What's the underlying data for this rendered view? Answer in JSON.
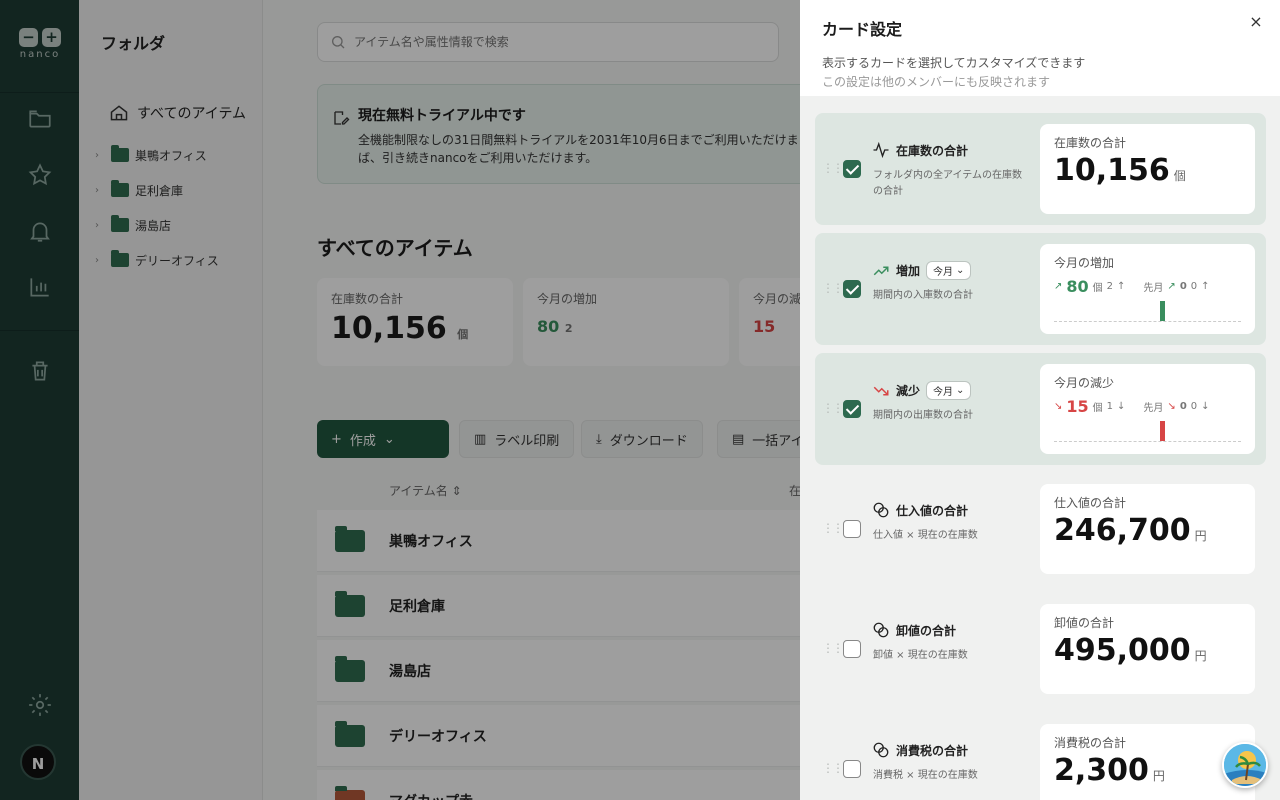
{
  "brand": {
    "logo_text": "nanco",
    "logo_mark_minus": "−",
    "logo_mark_plus": "+"
  },
  "user": {
    "avatar_initial": "N"
  },
  "folders": {
    "title": "フォルダ",
    "all_items": "すべてのアイテム",
    "items": [
      "巣鴨オフィス",
      "足利倉庫",
      "湯島店",
      "デリーオフィス"
    ]
  },
  "search": {
    "placeholder": "アイテム名や属性情報で検索"
  },
  "trial": {
    "title": "現在無料トライアル中です",
    "line1": "全機能制限なしの31日間無料トライアルを2031年10月6日までご利用いただけま",
    "line2": "ば、引き続きnancoをご利用いただけます。"
  },
  "main": {
    "heading": "すべてのアイテム",
    "cards": [
      {
        "title": "在庫数の合計",
        "value": "10,156",
        "unit": "個"
      },
      {
        "title": "今月の増加",
        "value": "80",
        "unit": "2"
      },
      {
        "title": "今月の減",
        "value": "15",
        "unit": ""
      }
    ],
    "toolbar": {
      "create": "作成",
      "label_print": "ラベル印刷",
      "download": "ダウンロード",
      "bulk": "一括アイ"
    },
    "column_header": "アイテム名",
    "column_header2": "在",
    "rows": [
      "巣鴨オフィス",
      "足利倉庫",
      "湯島店",
      "デリーオフィス",
      "マグカップ赤"
    ]
  },
  "panel": {
    "title": "カード設定",
    "subtitle1": "表示するカードを選択してカスタマイズできます",
    "subtitle2": "この設定は他のメンバーにも反映されます",
    "close_label": "×",
    "settings": [
      {
        "enabled": true,
        "icon": "activity-icon",
        "title": "在庫数の合計",
        "period": "",
        "desc": "フォルダ内の全アイテムの在庫数の合計",
        "preview": {
          "title": "在庫数の合計",
          "value": "10,156",
          "unit": "個"
        }
      },
      {
        "enabled": true,
        "icon": "trend-up-icon",
        "title": "増加",
        "period": "今月",
        "desc": "期間内の入庫数の合計",
        "preview": {
          "title": "今月の増加",
          "value": "80",
          "unit": "個",
          "count": "2",
          "prev_label": "先月",
          "prev_value": "0",
          "prev_count": "0",
          "bar_fraction": 1.0
        }
      },
      {
        "enabled": true,
        "icon": "trend-down-icon",
        "title": "減少",
        "period": "今月",
        "desc": "期間内の出庫数の合計",
        "preview": {
          "title": "今月の減少",
          "value": "15",
          "unit": "個",
          "count": "1",
          "prev_label": "先月",
          "prev_value": "0",
          "prev_count": "0",
          "bar_fraction": 1.0
        }
      },
      {
        "enabled": false,
        "icon": "coins-icon",
        "title": "仕入値の合計",
        "period": "",
        "desc": "仕入値 × 現在の在庫数",
        "preview": {
          "title": "仕入値の合計",
          "value": "246,700",
          "unit": "円"
        }
      },
      {
        "enabled": false,
        "icon": "coins-icon",
        "title": "卸値の合計",
        "period": "",
        "desc": "卸値 × 現在の在庫数",
        "preview": {
          "title": "卸値の合計",
          "value": "495,000",
          "unit": "円"
        }
      },
      {
        "enabled": false,
        "icon": "coins-icon",
        "title": "消費税の合計",
        "period": "",
        "desc": "消費税 × 現在の在庫数",
        "preview": {
          "title": "消費税の合計",
          "value": "2,300",
          "unit": "円"
        }
      }
    ]
  },
  "colors": {
    "accent": "#2d6a4f",
    "rail": "#1d3d35",
    "increase": "#3a8e5e",
    "decrease": "#d74545"
  }
}
